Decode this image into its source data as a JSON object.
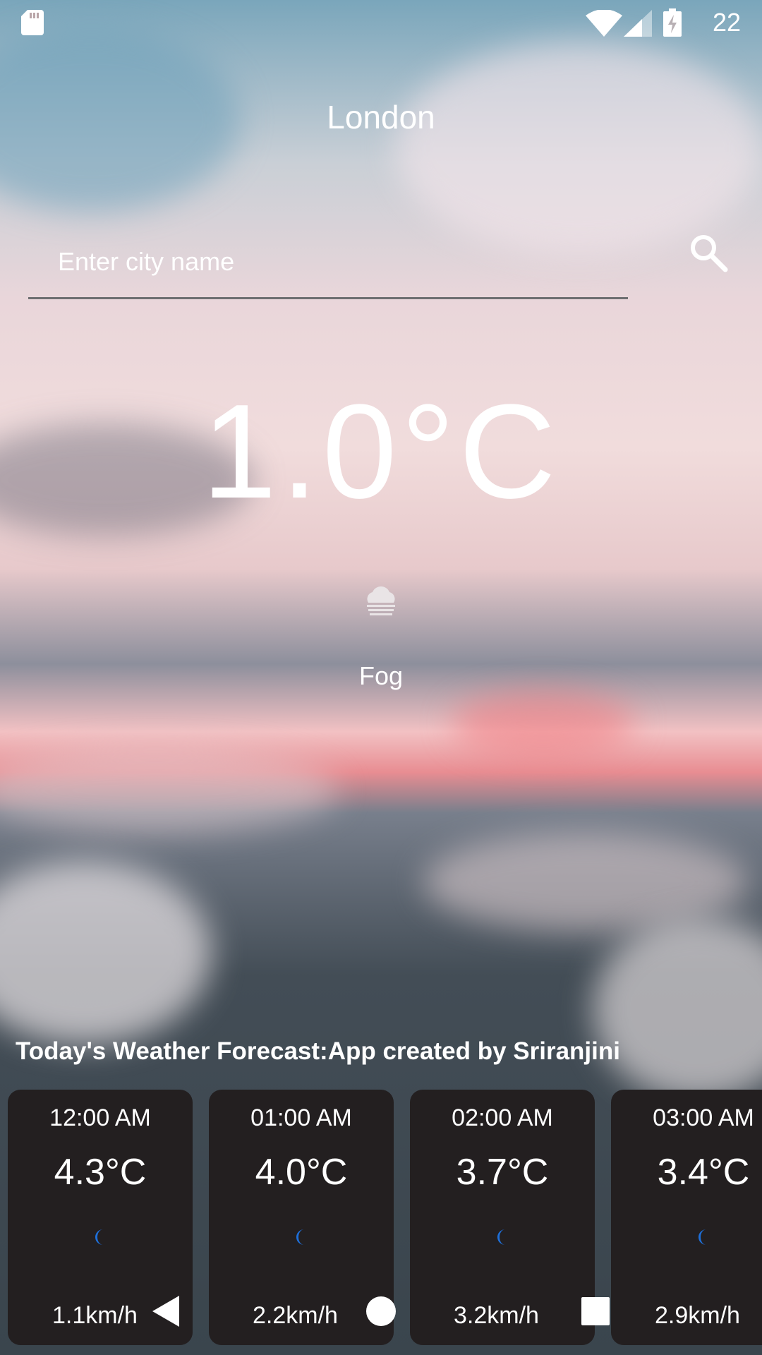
{
  "status_bar": {
    "time": "22",
    "icons": [
      "sd-card-icon",
      "wifi-icon",
      "cell-signal-icon",
      "battery-charging-icon"
    ]
  },
  "header": {
    "city": "London"
  },
  "search": {
    "placeholder": "Enter city name",
    "value": "",
    "icon": "search-icon"
  },
  "current": {
    "temperature": "1.0°C",
    "condition": "Fog",
    "condition_icon": "fog-cloud-icon"
  },
  "forecast": {
    "title": "Today's Weather Forecast:App created by Sriranjini",
    "items": [
      {
        "time": "12:00 AM",
        "temp": "4.3°C",
        "icon": "moon-icon",
        "wind": "1.1km/h"
      },
      {
        "time": "01:00 AM",
        "temp": "4.0°C",
        "icon": "moon-icon",
        "wind": "2.2km/h"
      },
      {
        "time": "02:00 AM",
        "temp": "3.7°C",
        "icon": "moon-icon",
        "wind": "3.2km/h"
      },
      {
        "time": "03:00 AM",
        "temp": "3.4°C",
        "icon": "moon-icon",
        "wind": "2.9km/h"
      }
    ]
  },
  "nav_bar": {
    "buttons": [
      "back-icon",
      "home-icon",
      "recents-icon"
    ]
  },
  "colors": {
    "card_background": "#231f20",
    "moon_icon": "#1e6fd9",
    "text": "#ffffff"
  }
}
